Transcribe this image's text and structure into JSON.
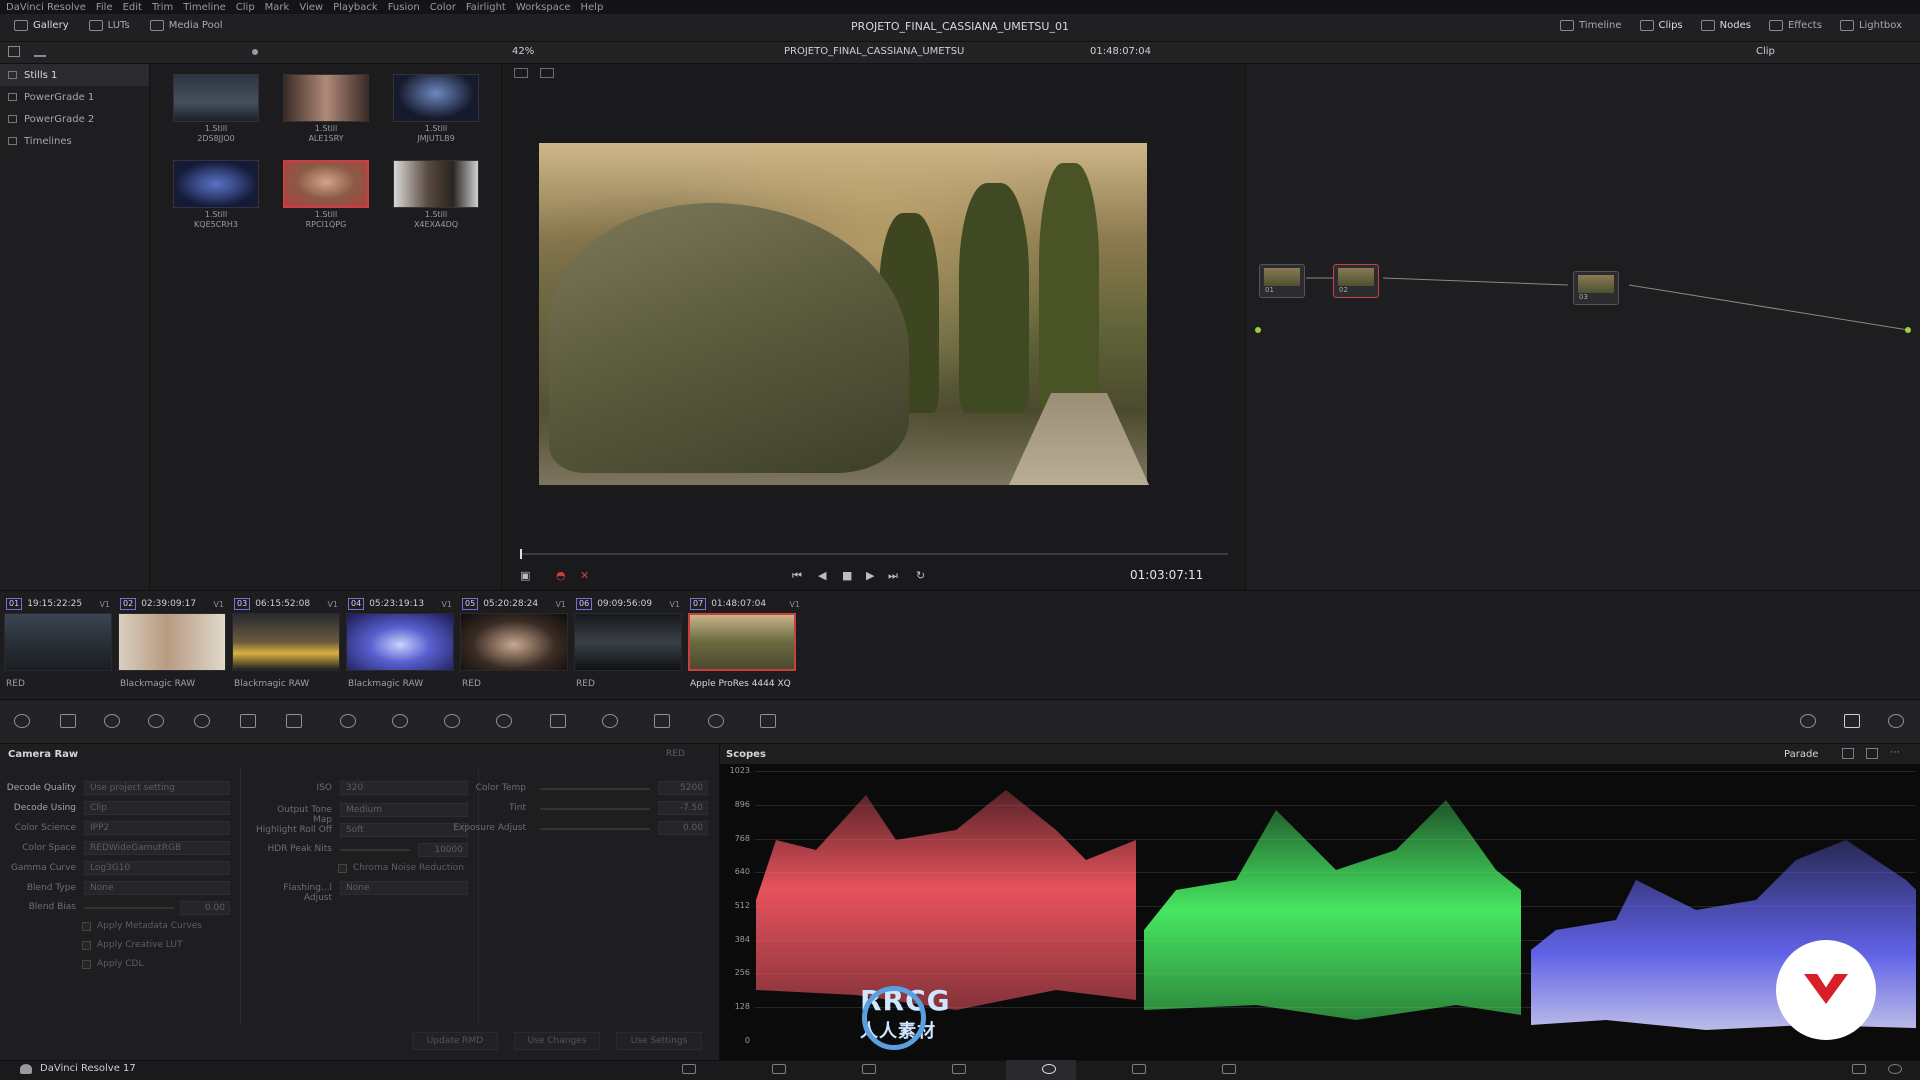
{
  "menu": [
    "DaVinci Resolve",
    "File",
    "Edit",
    "Trim",
    "Timeline",
    "Clip",
    "Mark",
    "View",
    "Playback",
    "Fusion",
    "Color",
    "Fairlight",
    "Workspace",
    "Help"
  ],
  "toolbar": {
    "left": [
      "Gallery",
      "LUTs",
      "Media Pool"
    ],
    "right": [
      "Timeline",
      "Clips",
      "Nodes",
      "Effects",
      "Lightbox"
    ],
    "project_title": "PROJETO_FINAL_CASSIANA_UMETSU_01"
  },
  "viewer": {
    "zoom": "42%",
    "timeline_name": "PROJETO_FINAL_CASSIANA_UMETSU",
    "source_timecode": "01:48:07:04",
    "playhead_timecode": "01:03:07:11",
    "node_mode": "Clip"
  },
  "gallery": {
    "sidebar": [
      "Stills 1",
      "PowerGrade 1",
      "PowerGrade 2",
      "Timelines"
    ],
    "stills": [
      {
        "type": "1.Still",
        "id": "2DS8JJO0"
      },
      {
        "type": "1.Still",
        "id": "ALE1SRY"
      },
      {
        "type": "1.Still",
        "id": "JMJUTLB9"
      },
      {
        "type": "1.Still",
        "id": "KQE5CRH3"
      },
      {
        "type": "1.Still",
        "id": "RPCI1QPG"
      },
      {
        "type": "1.Still",
        "id": "X4EXA4DQ"
      }
    ]
  },
  "nodes": [
    "01",
    "02",
    "03"
  ],
  "clips": [
    {
      "num": "01",
      "tc": "19:15:22:25",
      "track": "V1",
      "codec": "RED"
    },
    {
      "num": "02",
      "tc": "02:39:09:17",
      "track": "V1",
      "codec": "Blackmagic RAW"
    },
    {
      "num": "03",
      "tc": "06:15:52:08",
      "track": "V1",
      "codec": "Blackmagic RAW"
    },
    {
      "num": "04",
      "tc": "05:23:19:13",
      "track": "V1",
      "codec": "Blackmagic RAW"
    },
    {
      "num": "05",
      "tc": "05:20:28:24",
      "track": "V1",
      "codec": "RED"
    },
    {
      "num": "06",
      "tc": "09:09:56:09",
      "track": "V1",
      "codec": "RED"
    },
    {
      "num": "07",
      "tc": "01:48:07:04",
      "track": "V1",
      "codec": "Apple ProRes 4444 XQ"
    }
  ],
  "camera_raw": {
    "title": "Camera Raw",
    "tag": "RED",
    "col1": [
      {
        "label": "Decode Quality",
        "value": "Use project setting"
      },
      {
        "label": "Decode Using",
        "value": "Clip"
      },
      {
        "label": "Color Science",
        "value": "IPP2"
      },
      {
        "label": "Color Space",
        "value": "REDWideGamutRGB"
      },
      {
        "label": "Gamma Curve",
        "value": "Log3G10"
      },
      {
        "label": "Blend Type",
        "value": "None"
      },
      {
        "label": "Blend Bias",
        "value": "0.00"
      }
    ],
    "col1_checks": [
      "Apply Metadata Curves",
      "Apply Creative LUT",
      "Apply CDL"
    ],
    "col2": [
      {
        "label": "ISO",
        "value": "320"
      },
      {
        "label": "Output Tone Map",
        "value": "Medium"
      },
      {
        "label": "Highlight Roll Off",
        "value": "Soft"
      },
      {
        "label": "HDR Peak Nits",
        "value": "10000"
      }
    ],
    "col2_check": "Chroma Noise Reduction",
    "col2_last": {
      "label": "Flashing...l Adjust",
      "value": "None"
    },
    "col3": [
      {
        "label": "Color Temp",
        "value": "5200"
      },
      {
        "label": "Tint",
        "value": "-7.50"
      },
      {
        "label": "Exposure Adjust",
        "value": "0.00"
      }
    ],
    "buttons": [
      "Update RMD",
      "Use Changes",
      "Use Settings"
    ]
  },
  "scopes": {
    "title": "Scopes",
    "mode": "Parade",
    "y_ticks": [
      "1023",
      "896",
      "768",
      "640",
      "512",
      "384",
      "256",
      "128",
      "0"
    ]
  },
  "footer": {
    "app_name": "DaVinci Resolve 17"
  },
  "watermark": {
    "text": "RRCG",
    "sub": "人人素材"
  },
  "colors": {
    "red_wave": "#ff5a66",
    "green_wave": "#4dff6a",
    "blue_wave": "#6a6cff",
    "selection": "#c94040",
    "accent_num": "#7a6fd0"
  }
}
